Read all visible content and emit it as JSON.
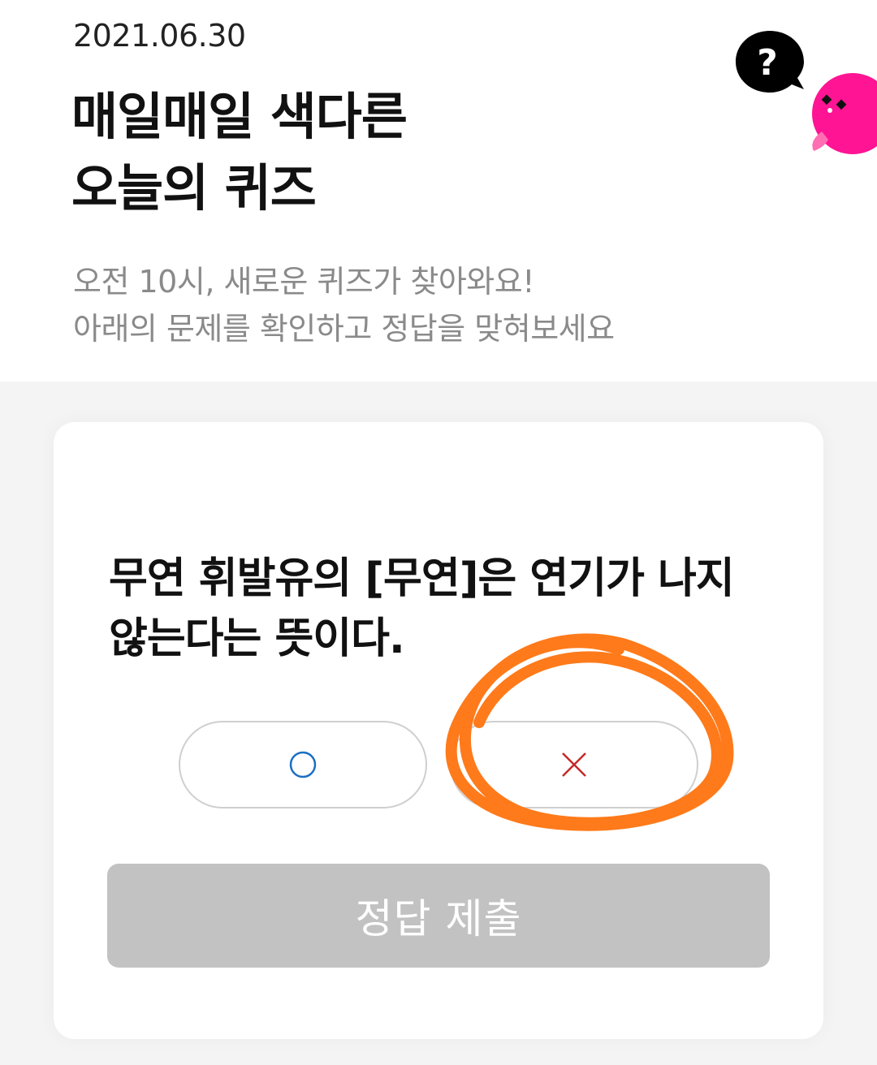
{
  "header": {
    "date": "2021.06.30",
    "title_line1": "매일매일 색다른",
    "title_line2": "오늘의 퀴즈",
    "subtitle_line1": "오전 10시, 새로운 퀴즈가 찾아와요!",
    "subtitle_line2": "아래의 문제를 확인하고 정답을 맞혀보세요",
    "help_icon": "question-bubble-icon",
    "help_label": "?"
  },
  "quiz": {
    "question": "무연 휘발유의 [무연]은 연기가 나지 않는다는 뜻이다.",
    "options": [
      {
        "id": "o",
        "icon": "circle-icon",
        "color": "#1a6fc4"
      },
      {
        "id": "x",
        "icon": "cross-icon",
        "color": "#c62828"
      }
    ],
    "selected_annotation": "x",
    "submit_label": "정답 제출"
  },
  "colors": {
    "annotation": "#ff7a1a",
    "submit_disabled": "#c2c2c2",
    "mascot": "#ff1493"
  }
}
